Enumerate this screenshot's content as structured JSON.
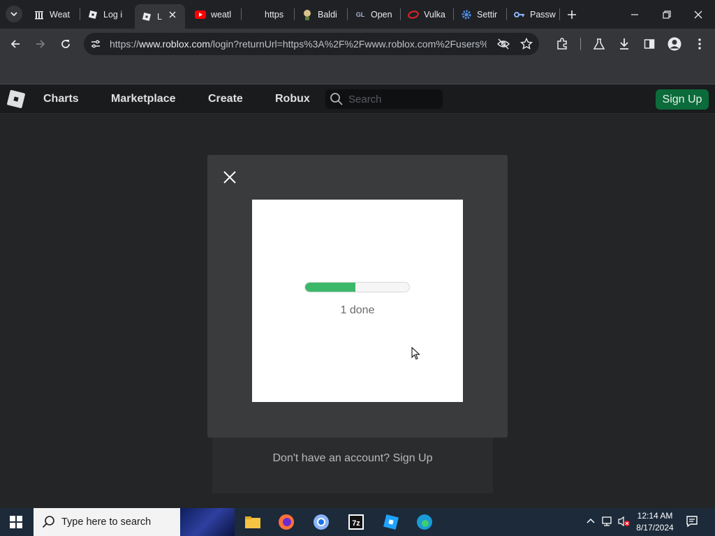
{
  "browser": {
    "tabs": [
      {
        "title": "Weat",
        "icon": "columns-icon"
      },
      {
        "title": "Log i",
        "icon": "roblox-icon"
      },
      {
        "title": "L",
        "icon": "roblox-icon",
        "active": true
      },
      {
        "title": "weatl",
        "icon": "youtube-icon"
      },
      {
        "title": "https",
        "icon": "blank-icon"
      },
      {
        "title": "Baldi",
        "icon": "baldi-icon"
      },
      {
        "title": "Open",
        "icon": "gl-icon"
      },
      {
        "title": "Vulka",
        "icon": "opera-icon"
      },
      {
        "title": "Settir",
        "icon": "gear-icon"
      },
      {
        "title": "Passw",
        "icon": "key-icon"
      }
    ],
    "url_prefix": "https://",
    "url_host": "www.roblox.com",
    "url_rest": "/login?returnUrl=https%3A%2F%2Fwww.roblox.com%2Fusers%..."
  },
  "roblox_nav": {
    "links": [
      "Charts",
      "Marketplace",
      "Create",
      "Robux"
    ],
    "search_placeholder": "Search",
    "signup_label": "Sign Up"
  },
  "modal": {
    "progress_fraction": 0.48,
    "progress_text": "1 done"
  },
  "behind": {
    "text": "Don't have an account? Sign Up"
  },
  "taskbar": {
    "search_placeholder": "Type here to search",
    "time": "12:14 AM",
    "date": "8/17/2024"
  },
  "colors": {
    "accent_green": "#3cb86b",
    "signup_green": "#0b6b3a"
  }
}
